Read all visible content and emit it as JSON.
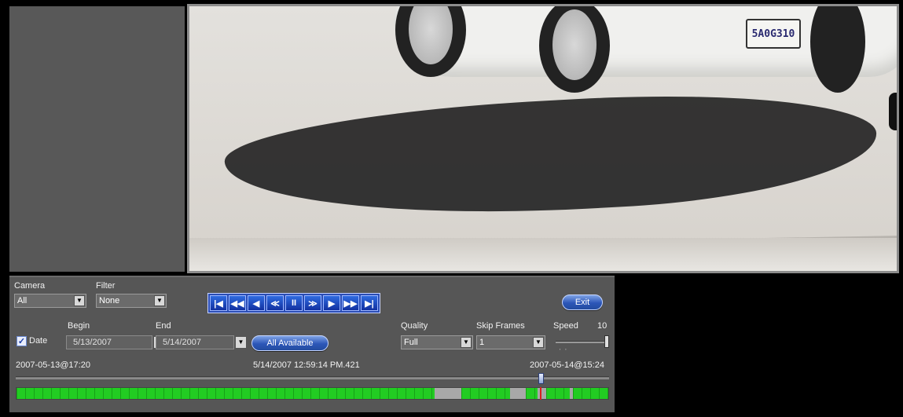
{
  "labels": {
    "camera": "Camera",
    "filter": "Filter",
    "date": "Date",
    "begin": "Begin",
    "end": "End",
    "quality": "Quality",
    "skip_frames": "Skip Frames",
    "speed": "Speed",
    "speed_value": "10"
  },
  "camera_select": {
    "value": "All"
  },
  "filter_select": {
    "value": "None"
  },
  "begin_date": "5/13/2007",
  "end_date": "5/14/2007",
  "quality_select": {
    "value": "Full"
  },
  "skip_frames_select": {
    "value": "1"
  },
  "date_checked": true,
  "buttons": {
    "all_available": "All Available",
    "exit": "Exit"
  },
  "transport": [
    {
      "name": "skip-to-start",
      "glyph": "|◀"
    },
    {
      "name": "fast-rewind",
      "glyph": "◀◀"
    },
    {
      "name": "step-back",
      "glyph": "◀"
    },
    {
      "name": "slow-back",
      "glyph": "≪"
    },
    {
      "name": "pause",
      "glyph": "II"
    },
    {
      "name": "slow-forward",
      "glyph": "≫"
    },
    {
      "name": "step-forward",
      "glyph": "▶"
    },
    {
      "name": "fast-forward",
      "glyph": "▶▶"
    },
    {
      "name": "skip-to-end",
      "glyph": "▶|"
    }
  ],
  "timeline": {
    "start": "2007-05-13@17:20",
    "current": "5/14/2007 12:59:14 PM.421",
    "end": "2007-05-14@15:24",
    "position_fraction": 0.885,
    "colors": {
      "recorded": "#22cc22",
      "gap": "#a8a8a8",
      "cursor": "#d62020"
    },
    "segments": [
      {
        "type": "recorded",
        "fraction": 0.706
      },
      {
        "type": "gap",
        "fraction": 0.046
      },
      {
        "type": "recorded",
        "fraction": 0.082
      },
      {
        "type": "gap",
        "fraction": 0.027
      },
      {
        "type": "recorded",
        "fraction": 0.02
      },
      {
        "type": "gap",
        "fraction": 0.014
      },
      {
        "type": "recorded",
        "fraction": 0.04
      },
      {
        "type": "gap",
        "fraction": 0.005
      },
      {
        "type": "recorded",
        "fraction": 0.06
      }
    ]
  },
  "video": {
    "plate_text": "5A0G310"
  },
  "speed_slider": {
    "value": 10,
    "max": 10
  }
}
